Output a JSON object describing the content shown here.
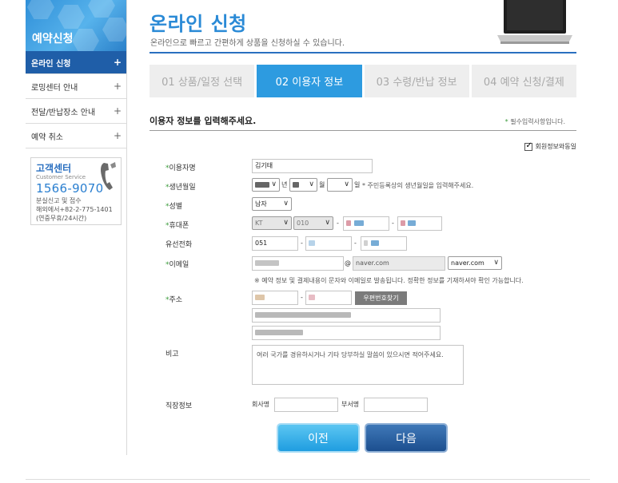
{
  "sidebar": {
    "title": "예약신청",
    "items": [
      {
        "label": "온라인 신청",
        "active": true
      },
      {
        "label": "로밍센터 안내",
        "active": false
      },
      {
        "label": "전달/반납장소 안내",
        "active": false
      },
      {
        "label": "예약 취소",
        "active": false
      }
    ],
    "customer_service": {
      "title": "고객센터",
      "subtitle": "Customer Service",
      "phone": "1566-9070",
      "line1": "분실신고 및 접수",
      "line2": "해외에서+82-2-775-1401",
      "line3": "(연중무휴/24시간)"
    }
  },
  "header": {
    "title": "온라인 신청",
    "subtitle": "온라인으로 빠르고 간편하게 상품을 신청하실 수 있습니다."
  },
  "steps": [
    {
      "label": "01 상품/일정 선택",
      "active": false
    },
    {
      "label": "02 이용자 정보",
      "active": true
    },
    {
      "label": "03 수령/반납 정보",
      "active": false
    },
    {
      "label": "04 예약 신청/결제",
      "active": false
    }
  ],
  "section": {
    "title": "이용자 정보를 입력해주세요.",
    "required_note": "필수입력사항입니다.",
    "same_member_label": "회원정보와동일",
    "same_member_checked": true
  },
  "form": {
    "name_label": "이용자명",
    "name_value": "김기태",
    "birth_label": "생년월일",
    "birth_year_suffix": "년",
    "birth_month_suffix": "월",
    "birth_day_suffix": "일",
    "birth_note": "* 주민등록상의 생년월일을 입력해주세요.",
    "gender_label": "성별",
    "gender_value": "남자",
    "mobile_label": "휴대폰",
    "mobile_carrier": "KT",
    "mobile_prefix": "010",
    "phone_label": "유선전화",
    "phone_area": "051",
    "email_label": "이메일",
    "email_domain": "naver.com",
    "email_domain_select": "naver.com",
    "email_note": "※ 예약 정보 및 결제내용이 문자와 이메일로 발송됩니다. 정확한 정보를 기재하셔야 확인 가능합니다.",
    "address_label": "주소",
    "zip_button": "우편번호찾기",
    "remarks_label": "비고",
    "remarks_placeholder": "여러 국가를 경유하시거나 기타 당부하실 말씀이 있으시면 적어주세요.",
    "company_label": "직장정보",
    "company_name_label": "회사명",
    "department_label": "부서명"
  },
  "buttons": {
    "prev": "이전",
    "next": "다음"
  }
}
